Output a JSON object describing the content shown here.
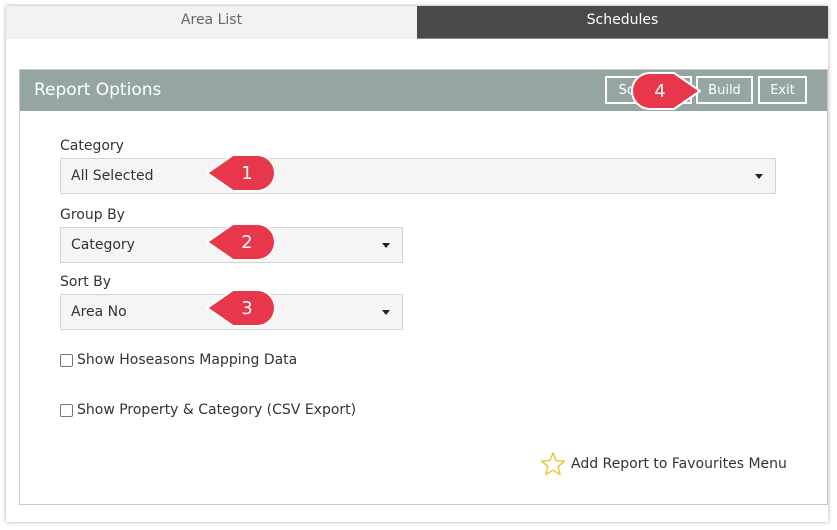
{
  "tabs": [
    {
      "label": "Area List",
      "active": true
    },
    {
      "label": "Schedules",
      "active": false
    }
  ],
  "panel": {
    "title": "Report Options",
    "buttons": {
      "schedule": "Schedule",
      "build": "Build",
      "exit": "Exit"
    }
  },
  "fields": {
    "category": {
      "label": "Category",
      "value": "All Selected"
    },
    "group_by": {
      "label": "Group By",
      "value": "Category"
    },
    "sort_by": {
      "label": "Sort By",
      "value": "Area No"
    }
  },
  "checkboxes": {
    "mapping": {
      "label": "Show Hoseasons Mapping Data",
      "checked": false
    },
    "csv": {
      "label": "Show Property & Category (CSV Export)",
      "checked": false
    }
  },
  "favourites": {
    "label": "Add Report to Favourites Menu",
    "icon": "star-outline-icon"
  },
  "callouts": [
    "1",
    "2",
    "3",
    "4"
  ],
  "colors": {
    "header": "#95a5a4",
    "active_tab": "#4a4a4a",
    "callout": "#e8374a",
    "star": "#e8c62a"
  }
}
